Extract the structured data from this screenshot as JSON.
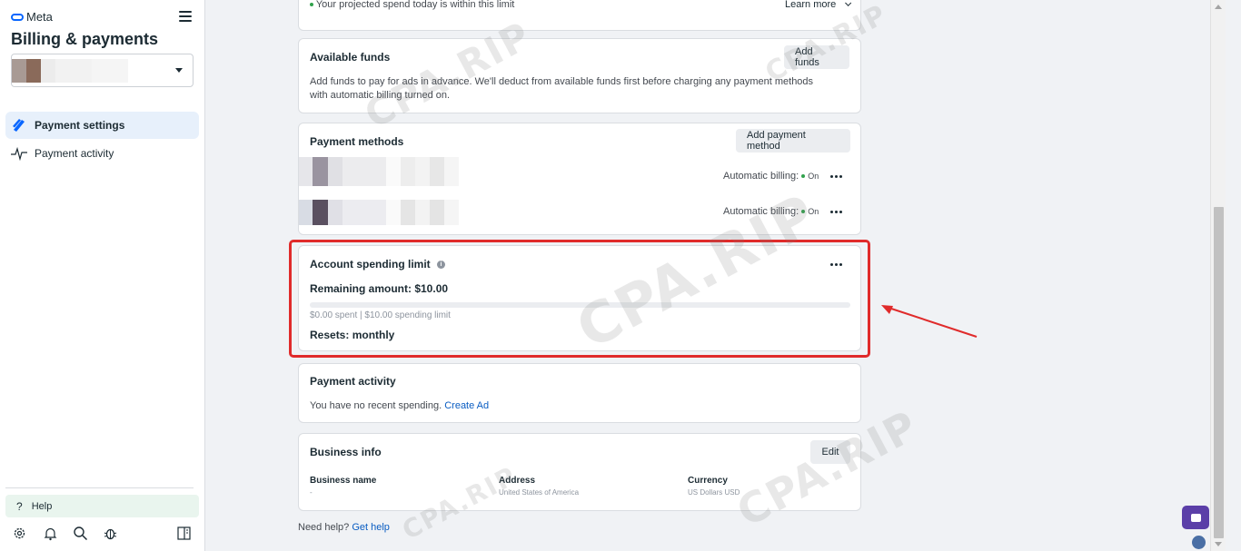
{
  "sidebar": {
    "brand": "Meta",
    "title": "Billing & payments",
    "nav": [
      {
        "label": "Payment settings"
      },
      {
        "label": "Payment activity"
      }
    ],
    "help_label": "Help"
  },
  "projected": {
    "text": "Your projected spend today is within this limit",
    "learn_more": "Learn more"
  },
  "available_funds": {
    "title": "Available funds",
    "button": "Add funds",
    "description": "Add funds to pay for ads in advance. We'll deduct from available funds first before charging any payment methods with automatic billing turned on."
  },
  "payment_methods": {
    "title": "Payment methods",
    "button": "Add payment method",
    "items": [
      {
        "billing_label": "Automatic billing:",
        "status": "On"
      },
      {
        "billing_label": "Automatic billing:",
        "status": "On"
      }
    ]
  },
  "spending_limit": {
    "title": "Account spending limit",
    "remaining": "Remaining amount: $10.00",
    "progress_fraction": 0.0,
    "spent_text": "$0.00 spent | $10.00 spending limit",
    "resets": "Resets: monthly"
  },
  "payment_activity": {
    "title": "Payment activity",
    "text": "You have no recent spending.",
    "link": "Create Ad"
  },
  "business_info": {
    "title": "Business info",
    "button": "Edit",
    "fields": [
      {
        "label": "Business name",
        "value": "-"
      },
      {
        "label": "Address",
        "value": "United States of America"
      },
      {
        "label": "Currency",
        "value": "US Dollars USD"
      }
    ]
  },
  "footer": {
    "text": "Need help?",
    "link": "Get help"
  },
  "watermark": "CPA.RIP",
  "colors": {
    "accent": "#0866ff",
    "highlight": "#e02b2b",
    "link": "#0a5dc2",
    "status_on": "#31a24c"
  }
}
